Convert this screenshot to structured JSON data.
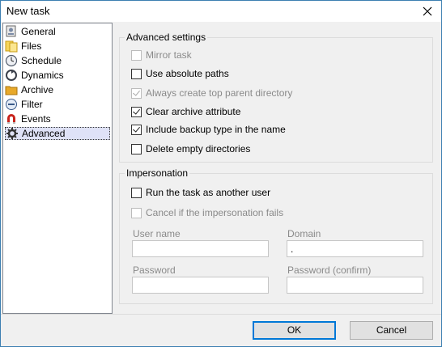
{
  "window": {
    "title": "New task"
  },
  "sidebar": {
    "items": [
      {
        "label": "General",
        "icon": "general-icon"
      },
      {
        "label": "Files",
        "icon": "files-icon"
      },
      {
        "label": "Schedule",
        "icon": "schedule-icon"
      },
      {
        "label": "Dynamics",
        "icon": "dynamics-icon"
      },
      {
        "label": "Archive",
        "icon": "archive-icon"
      },
      {
        "label": "Filter",
        "icon": "filter-icon"
      },
      {
        "label": "Events",
        "icon": "events-icon"
      },
      {
        "label": "Advanced",
        "icon": "advanced-icon",
        "selected": true
      }
    ]
  },
  "advanced_settings": {
    "title": "Advanced settings",
    "options": [
      {
        "label": "Mirror task",
        "checked": false,
        "enabled": false
      },
      {
        "label": "Use absolute paths",
        "checked": false,
        "enabled": true
      },
      {
        "label": "Always create top parent directory",
        "checked": true,
        "enabled": false
      },
      {
        "label": "Clear archive attribute",
        "checked": true,
        "enabled": true
      },
      {
        "label": "Include backup type in the name",
        "checked": true,
        "enabled": true
      },
      {
        "label": "Delete empty directories",
        "checked": false,
        "enabled": true
      }
    ]
  },
  "impersonation": {
    "title": "Impersonation",
    "run_as_other": {
      "label": "Run the task as another user",
      "checked": false,
      "enabled": true
    },
    "cancel_if_fails": {
      "label": "Cancel if the impersonation fails",
      "checked": false,
      "enabled": false
    },
    "user_name": {
      "label": "User name",
      "value": ""
    },
    "domain": {
      "label": "Domain",
      "value": "."
    },
    "password": {
      "label": "Password",
      "value": ""
    },
    "password_confirm": {
      "label": "Password (confirm)",
      "value": ""
    }
  },
  "buttons": {
    "ok": "OK",
    "cancel": "Cancel"
  },
  "colors": {
    "accent": "#0078d7",
    "selection": "#dfe2f7"
  }
}
